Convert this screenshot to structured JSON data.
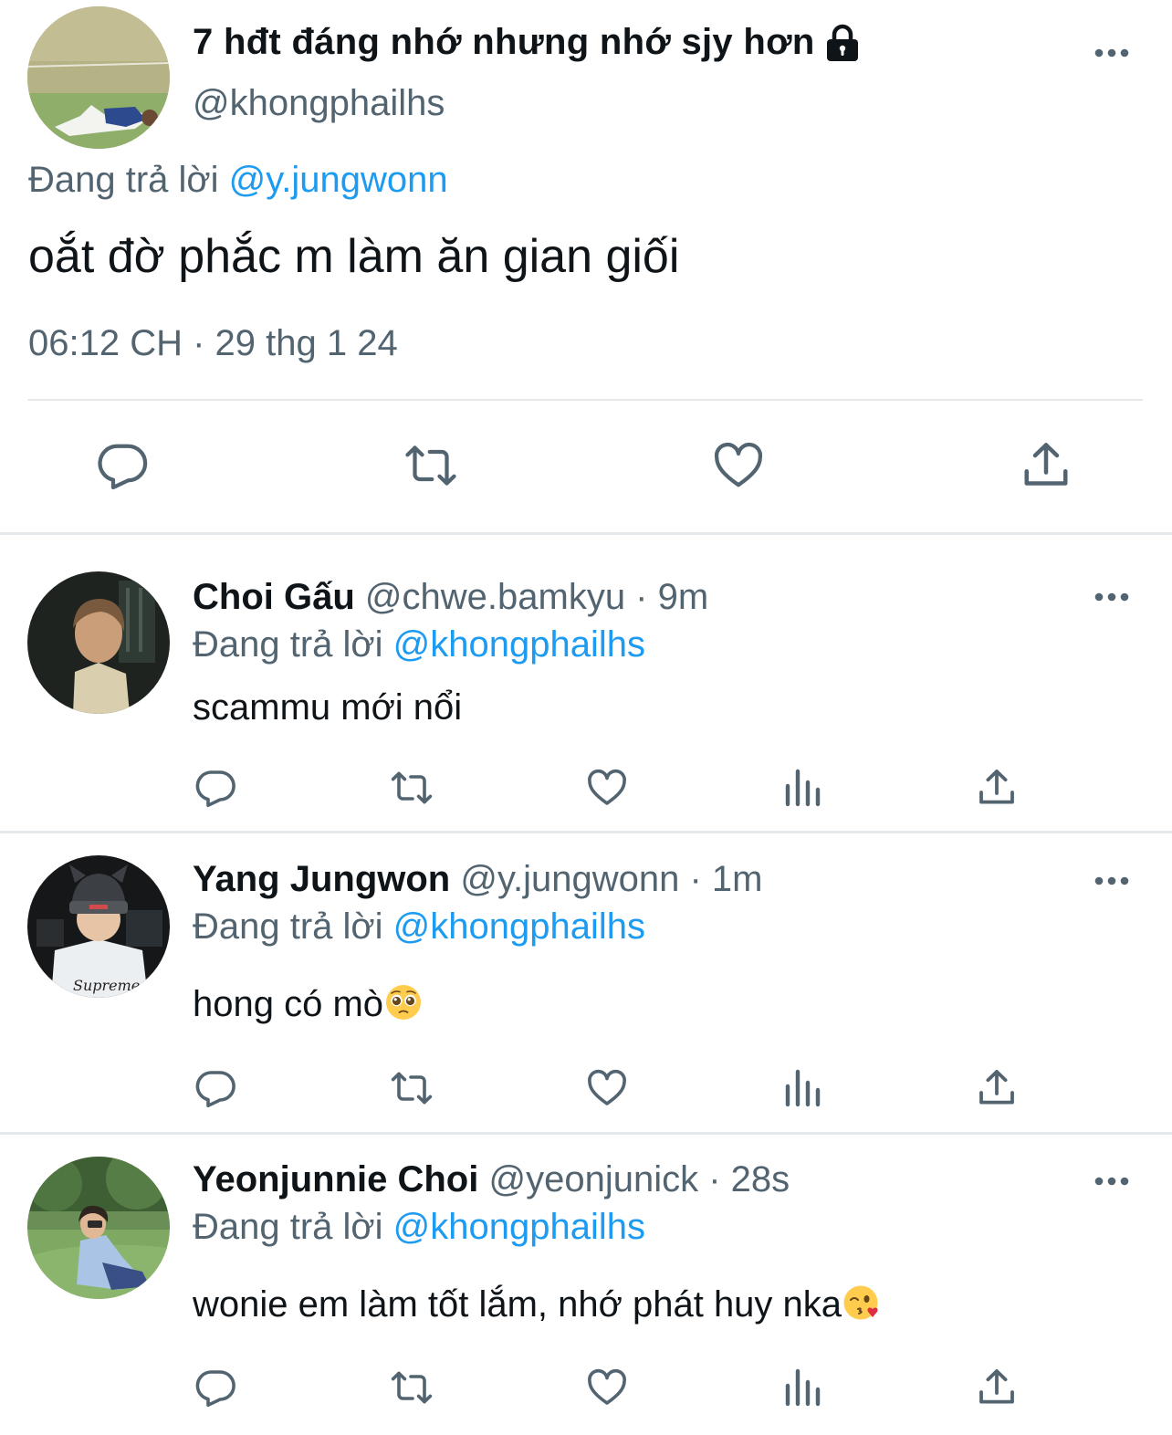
{
  "main_tweet": {
    "display_name": "7 hđt đáng nhớ nhưng nhớ sjy hơn",
    "handle": "@khongphailhs",
    "protected_icon": "lock-icon",
    "replying_prefix": "Đang trả lời",
    "replying_to": "@y.jungwonn",
    "text": "oắt đờ phắc m làm ăn gian giối",
    "timestamp": "06:12 CH · 29 thg 1 24",
    "actions": [
      "reply-icon",
      "retweet-icon",
      "like-icon",
      "share-icon"
    ]
  },
  "replies": [
    {
      "display_name": "Choi Gấu",
      "meta": "@chwe.bamkyu · 9m",
      "replying_prefix": "Đang trả lời",
      "replying_to": "@khongphailhs",
      "text": "scammu mới nổi",
      "emoji": ""
    },
    {
      "display_name": "Yang Jungwon",
      "meta": "@y.jungwonn · 1m",
      "replying_prefix": "Đang trả lời",
      "replying_to": "@khongphailhs",
      "text": "hong có mò",
      "emoji": "pleading-face-emoji"
    },
    {
      "display_name": "Yeonjunnie Choi",
      "meta": "@yeonjunick · 28s",
      "replying_prefix": "Đang trả lời",
      "replying_to": "@khongphailhs",
      "text": "wonie em làm tốt lắm, nhớ phát huy nka",
      "emoji": "face-blowing-kiss-emoji"
    }
  ],
  "reply_actions": [
    "reply-icon",
    "retweet-icon",
    "like-icon",
    "views-icon",
    "share-icon"
  ],
  "colors": {
    "text": "#0f1419",
    "secondary": "#536471",
    "accent": "#1d9bf0",
    "divider": "#e6e9eb"
  }
}
